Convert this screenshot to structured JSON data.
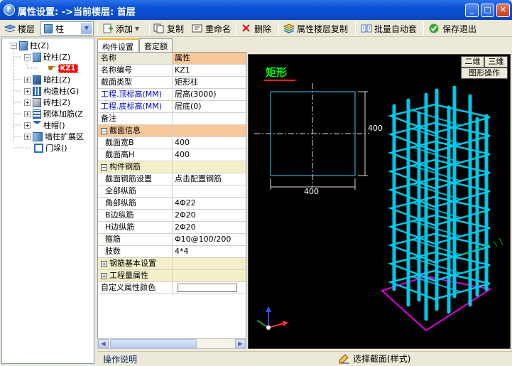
{
  "window": {
    "title": "属性设置: ->当前楼层: 首层",
    "app_icon_letter": "F",
    "minimize": "_",
    "maximize": "□",
    "close": "✕"
  },
  "toolbar": {
    "floor_label": "楼层",
    "component_select": "柱",
    "add": "添加",
    "copy": "复制",
    "rename": "重命名",
    "delete": "删除",
    "floor_copy": "属性楼层复制",
    "batch_auto": "批量自动套",
    "save_exit": "保存退出"
  },
  "tree": {
    "root": "柱(Z)",
    "items": [
      {
        "label": "砼柱(Z)",
        "expanded": true
      },
      {
        "label": "KZ1",
        "selected": true
      },
      {
        "label": "暗柱(Z)"
      },
      {
        "label": "构造柱(G)"
      },
      {
        "label": "砖柱(Z)"
      },
      {
        "label": "砌体加筋(Z"
      },
      {
        "label": "柱帽()"
      },
      {
        "label": "墙柱扩展区"
      },
      {
        "label": "门垛()"
      }
    ]
  },
  "tabs": [
    "构件设置",
    "套定额"
  ],
  "grid": {
    "header": {
      "name": "名称",
      "value": "属性"
    },
    "rows": [
      {
        "name": "名称编号",
        "value": "KZ1"
      },
      {
        "name": "截面类型",
        "value": "矩形柱"
      },
      {
        "name": "工程.顶标高(MM)",
        "value": "层高(3000)"
      },
      {
        "name": "工程.底标高(MM)",
        "value": "层底(0)"
      },
      {
        "name": "备注",
        "value": ""
      },
      {
        "name": "截面信息",
        "value": ""
      },
      {
        "name": "截面宽B",
        "value": "400"
      },
      {
        "name": "截面高H",
        "value": "400"
      },
      {
        "name": "构件钢筋",
        "value": ""
      },
      {
        "name": "截面钢筋设置",
        "value": "点击配置钢筋"
      },
      {
        "name": "全部纵筋",
        "value": ""
      },
      {
        "name": "角部纵筋",
        "value": "4Φ22"
      },
      {
        "name": "B边纵筋",
        "value": "2Φ20"
      },
      {
        "name": "H边纵筋",
        "value": "2Φ20"
      },
      {
        "name": "箍筋",
        "value": "Φ10@100/200"
      },
      {
        "name": "肢数",
        "value": "4*4"
      },
      {
        "name": "钢筋基本设置",
        "value": ""
      },
      {
        "name": "工程量属性",
        "value": ""
      },
      {
        "name": "自定义属性颜色",
        "value": ""
      }
    ]
  },
  "viewport": {
    "section_label": "矩形",
    "dim_width": "400",
    "dim_height": "400",
    "btn_2d": "二维",
    "btn_3d": "三维",
    "btn_graphic_ops": "图形操作",
    "colors": {
      "rebar": "#00C8E6",
      "label": "#00FF00",
      "frame": "#33CCFF",
      "base": "#E000E0"
    }
  },
  "status": {
    "left": "操作说明",
    "right": "选择截面(样式)"
  }
}
